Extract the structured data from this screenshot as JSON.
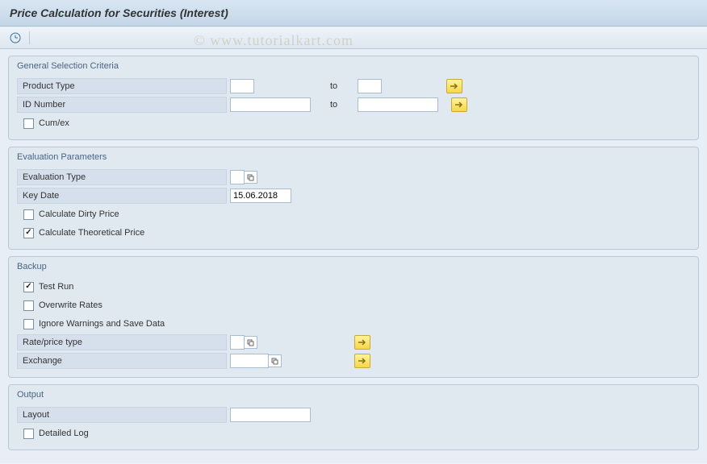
{
  "title": "Price Calculation for Securities (Interest)",
  "watermark": "© www.tutorialkart.com",
  "groups": {
    "general": {
      "title": "General Selection Criteria",
      "product_type_label": "Product Type",
      "product_type_from": "",
      "product_type_to": "",
      "id_number_label": "ID Number",
      "id_number_from": "",
      "id_number_to": "",
      "to_label": "to",
      "cum_ex_label": "Cum/ex",
      "cum_ex_checked": false
    },
    "evaluation": {
      "title": "Evaluation Parameters",
      "evaluation_type_label": "Evaluation Type",
      "evaluation_type_value": "",
      "key_date_label": "Key Date",
      "key_date_value": "15.06.2018",
      "calc_dirty_label": "Calculate Dirty Price",
      "calc_dirty_checked": false,
      "calc_theo_label": "Calculate Theoretical Price",
      "calc_theo_checked": true
    },
    "backup": {
      "title": "Backup",
      "test_run_label": "Test Run",
      "test_run_checked": true,
      "overwrite_label": "Overwrite Rates",
      "overwrite_checked": false,
      "ignore_label": "Ignore Warnings and Save Data",
      "ignore_checked": false,
      "rate_price_label": "Rate/price type",
      "rate_price_value": "",
      "exchange_label": "Exchange",
      "exchange_value": ""
    },
    "output": {
      "title": "Output",
      "layout_label": "Layout",
      "layout_value": "",
      "detailed_log_label": "Detailed Log",
      "detailed_log_checked": false
    }
  }
}
